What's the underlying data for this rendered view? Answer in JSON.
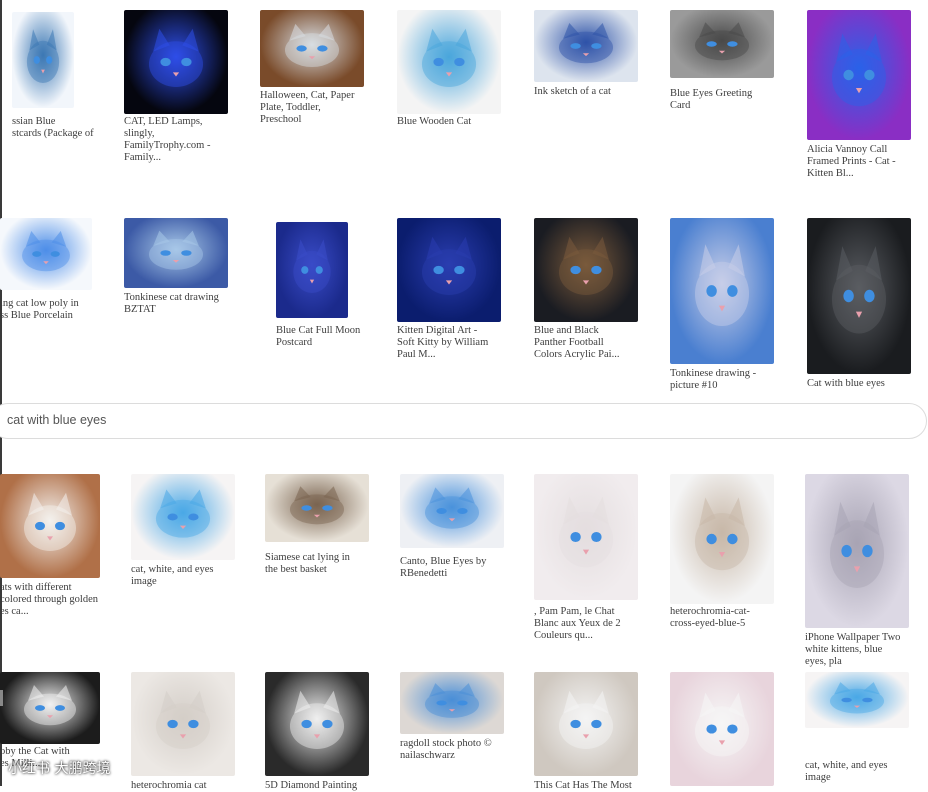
{
  "search": {
    "query": "cat with blue eyes"
  },
  "watermark": "小红书 大鹏跨境",
  "row1": [
    {
      "caption": "ssian Blue\nstcards (Package of",
      "colors": [
        "#f2f6fb",
        "#3c78b4"
      ]
    },
    {
      "caption": "CAT, LED Lamps,\nslingly,\nFamilyTrophy.com -\nFamily...",
      "colors": [
        "#05060f",
        "#2e4ee8"
      ]
    },
    {
      "caption": "Halloween, Cat, Paper\nPlate, Toddler,\nPreschool",
      "colors": [
        "#7a4b2a",
        "#d8dde2"
      ]
    },
    {
      "caption": "Blue Wooden Cat",
      "colors": [
        "#f4f4f4",
        "#4aa6dc"
      ]
    },
    {
      "caption": "Ink sketch of a cat",
      "colors": [
        "#dde4ee",
        "#2e53a8"
      ]
    },
    {
      "caption": "Blue Eyes Greeting\nCard",
      "colors": [
        "#9a9a9a",
        "#4a4a4a"
      ]
    },
    {
      "caption": "Alicia Vannoy Call\nFramed Prints - Cat -\nKitten Bl...",
      "colors": [
        "#8a2ec4",
        "#2a62e8"
      ]
    }
  ],
  "row2": [
    {
      "caption": "ing cat low poly in\nss Blue Porcelain",
      "colors": [
        "#f5f8fc",
        "#4d8ee8"
      ]
    },
    {
      "caption": "Tonkinese cat drawing\nBZTAT",
      "colors": [
        "#3c5aa6",
        "#a8c8e8"
      ]
    },
    {
      "caption": "Blue Cat Full Moon\nPostcard",
      "colors": [
        "#1b2a8c",
        "#3a4cc8"
      ]
    },
    {
      "caption": "Kitten Digital Art -\nSoft Kitty by William\nPaul M...",
      "colors": [
        "#0b1d6e",
        "#2a3db0"
      ]
    },
    {
      "caption": "Blue and Black\nPanther Football\nColors Acrylic Pai...",
      "colors": [
        "#1a1c22",
        "#7a5a3c"
      ]
    },
    {
      "caption": "Tonkinese drawing -\npicture #10",
      "colors": [
        "#4a7fd0",
        "#c8cee8"
      ]
    },
    {
      "caption": "Cat with blue eyes",
      "colors": [
        "#1a1c1f",
        "#5a5d62"
      ]
    }
  ],
  "row3": [
    {
      "caption": "ats with different\ncolored through golden\nes ca...",
      "colors": [
        "#b07048",
        "#f4f1ee"
      ]
    },
    {
      "caption": "cat, white, and eyes\nimage",
      "colors": [
        "#f6f4f4",
        "#4aa8e6"
      ]
    },
    {
      "caption": "Siamese cat lying in\nthe best basket",
      "colors": [
        "#e6e0d6",
        "#7a6450"
      ]
    },
    {
      "caption": "Canto, Blue Eyes by\nRBenedetti",
      "colors": [
        "#eef0f4",
        "#4a92dc"
      ]
    },
    {
      "caption": ", Pam Pam, le Chat\nBlanc aux Yeux de 2\nCouleurs qu...",
      "colors": [
        "#f1ecee",
        "#e4dedf"
      ]
    },
    {
      "caption": "heterochromia-cat-\ncross-eyed-blue-5",
      "colors": [
        "#f4f4f4",
        "#c8b8a8"
      ]
    },
    {
      "caption": "iPhone Wallpaper Two\nwhite kittens, blue\neyes, pla",
      "colors": [
        "#dcd8e4",
        "#a8a4b4"
      ]
    }
  ],
  "row4": [
    {
      "caption": "oby the Cat with\nes Milli...",
      "colors": [
        "#1c1c1c",
        "#f2f2f2"
      ]
    },
    {
      "caption": "heterochromia cat",
      "colors": [
        "#ece8e4",
        "#d4cec8"
      ]
    },
    {
      "caption": "5D Diamond Painting",
      "colors": [
        "#2a2a2a",
        "#f0f0f0"
      ]
    },
    {
      "caption": "ragdoll stock photo ©\nnailaschwarz",
      "colors": [
        "#ddd8d4",
        "#4a8fd8"
      ]
    },
    {
      "caption": "This Cat Has The Most",
      "colors": [
        "#cfc8c0",
        "#f4f4f4"
      ]
    },
    {
      "caption": "",
      "colors": [
        "#e8d4dc",
        "#f6f6f6"
      ]
    },
    {
      "caption": "cat, white, and eyes\nimage",
      "colors": [
        "#f6f4f4",
        "#4aa8e6"
      ]
    }
  ]
}
